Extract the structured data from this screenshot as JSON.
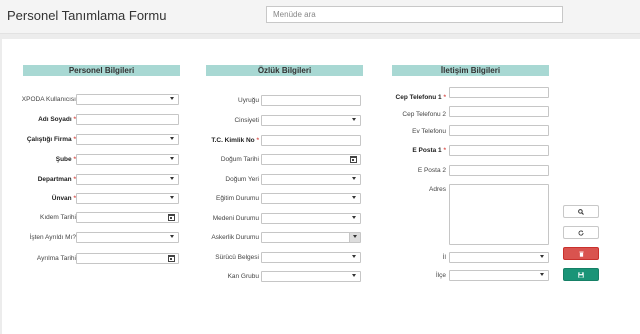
{
  "app": {
    "title": "Personel Tanımlama Formu",
    "search_placeholder": "Menüde ara"
  },
  "sections": {
    "personel": "Personel Bilgileri",
    "ozluk": "Özlük Bilgileri",
    "iletisim": "İletişim Bilgileri"
  },
  "personel": {
    "kullanici": "XPODA Kullanıcısı",
    "ad_soyad": "Adı Soyadı",
    "firma": "Çalıştığı Firma",
    "sube": "Şube",
    "departman": "Departman",
    "unvan": "Ünvan",
    "kidem": "Kıdem Tarihi",
    "isten_ayrildi": "İşten Ayrıldı Mı?",
    "ayrilma": "Ayrılma Tarihi"
  },
  "ozluk": {
    "uyrugu": "Uyruğu",
    "cinsiyeti": "Cinsiyeti",
    "tc": "T.C. Kimlik No",
    "dogum_tarihi": "Doğum Tarihi",
    "dogum_yeri": "Doğum Yeri",
    "egitim": "Eğitim Durumu",
    "medeni": "Medeni Durumu",
    "askerlik": "Askerlik Durumu",
    "surucu": "Sürücü Belgesi",
    "kan": "Kan Grubu"
  },
  "iletisim": {
    "cep1": "Cep Telefonu 1",
    "cep2": "Cep Telefonu 2",
    "ev": "Ev Telefonu",
    "eposta1": "E Posta 1",
    "eposta2": "E Posta 2",
    "adres": "Adres",
    "il": "İl",
    "ilce": "İlçe"
  },
  "required_marker": "*",
  "icons": {
    "search": "search-icon",
    "refresh": "refresh-icon",
    "delete": "trash-icon",
    "save": "save-icon"
  },
  "colors": {
    "section_header": "#a8d8d3",
    "delete_button": "#d9534f",
    "save_button": "#1a9477",
    "required": "#d9534f"
  }
}
